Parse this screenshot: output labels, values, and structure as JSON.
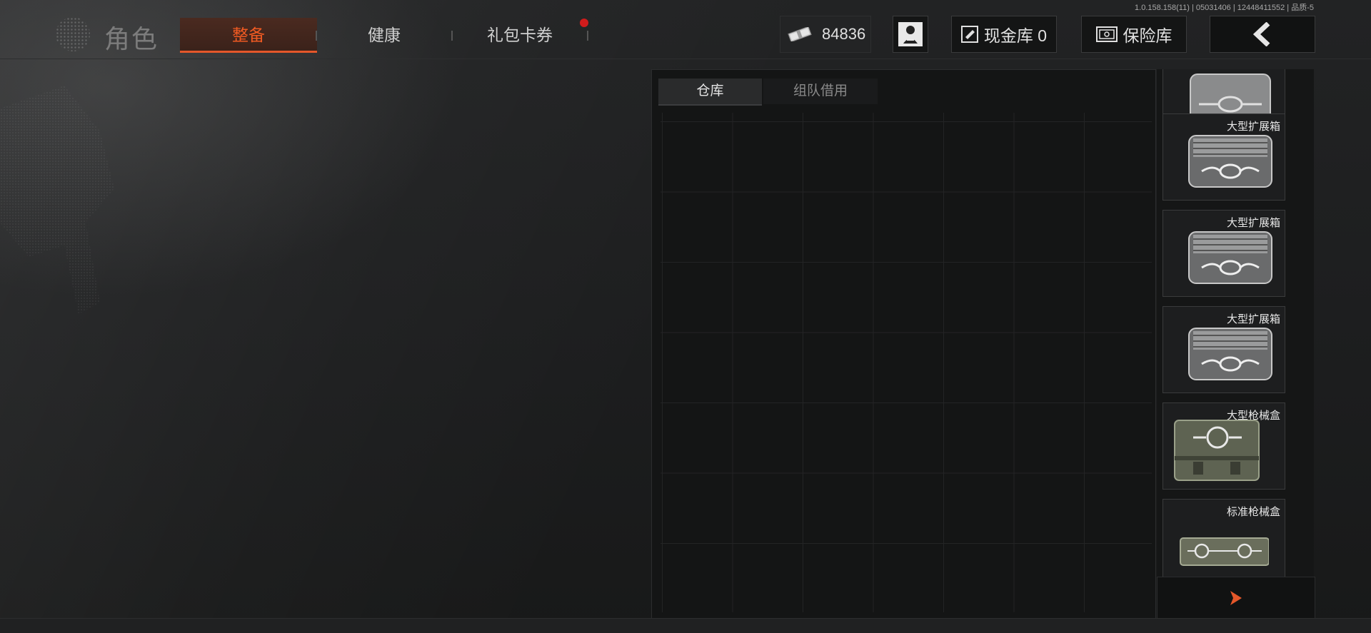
{
  "version_text": "1.0.158.158(11) | 05031406 | 12448411552 | 品质-5",
  "header": {
    "title": "角色",
    "tabs": [
      {
        "label": "整备",
        "active": true
      },
      {
        "label": "健康",
        "active": false
      },
      {
        "label": "礼包卡券",
        "active": false,
        "has_badge": true
      }
    ],
    "money": "84836",
    "cash_vault_label": "现金库 0",
    "safe_label": "保险库",
    "icons": {
      "money": "cash-bundle-icon",
      "profile": "operator-icon",
      "cash_vault": "ticket-icon",
      "safe": "safe-icon",
      "back": "back-arrow-icon"
    }
  },
  "storage": {
    "tabs": [
      {
        "label": "仓库",
        "active": true
      },
      {
        "label": "组队借用",
        "active": false
      }
    ]
  },
  "items": [
    {
      "name": "",
      "type": "expansion-box"
    },
    {
      "name": "大型扩展箱",
      "type": "expansion-box"
    },
    {
      "name": "大型扩展箱",
      "type": "expansion-box"
    },
    {
      "name": "大型扩展箱",
      "type": "expansion-box"
    },
    {
      "name": "大型枪械盒",
      "type": "gun-case-large"
    },
    {
      "name": "标准枪械盒",
      "type": "gun-case-standard"
    }
  ],
  "colors": {
    "accent": "#e4572a",
    "badge": "#d01c1c"
  }
}
